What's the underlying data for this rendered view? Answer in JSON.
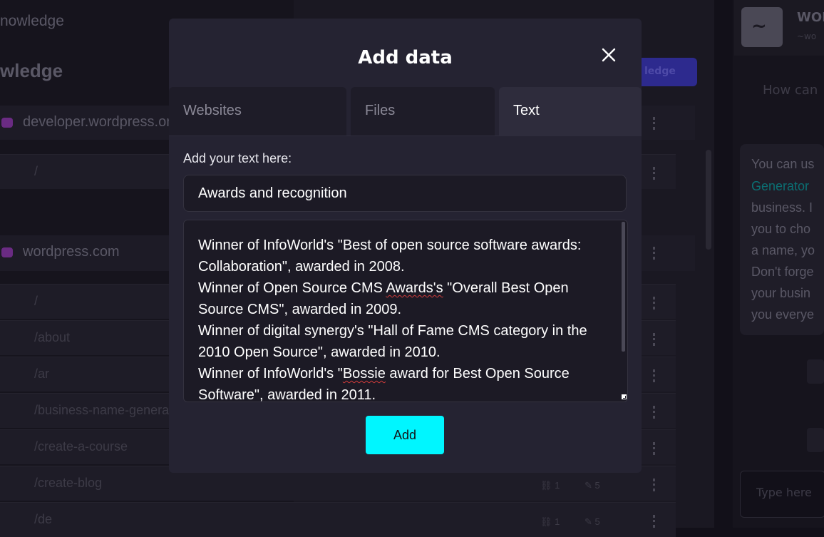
{
  "background": {
    "left_title_partial": "nowledge",
    "left_heading_partial": "wledge",
    "sites": [
      {
        "name": "developer.wordpress.org",
        "paths": [
          "/"
        ]
      },
      {
        "name": "wordpress.com",
        "paths": [
          "/",
          "/about",
          "/ar",
          "/business-name-generator",
          "/create-a-course",
          "/create-blog",
          "/de"
        ]
      }
    ],
    "stat_links": "1",
    "stat_pages": "5",
    "add_knowledge_partial": "ledge",
    "brand_partial": "WOR",
    "brand_sub_partial": "~wo",
    "chat_hint_partial": "How can",
    "chat_lines": [
      "You can us",
      "Generator",
      "business. I",
      "you to cho",
      "a name, yo",
      "Don't forge",
      "your busin",
      "you everye"
    ],
    "chat_input_placeholder": "Type here",
    "logo_glyph": "~"
  },
  "modal": {
    "title": "Add data",
    "close_icon": "close-icon",
    "tabs": [
      {
        "label": "Websites",
        "active": false
      },
      {
        "label": "Files",
        "active": false
      },
      {
        "label": "Text",
        "active": true
      }
    ],
    "field_label": "Add your text here:",
    "title_value": "Awards and recognition",
    "body_paragraphs": [
      {
        "before": "Winner of InfoWorld's \"Best of open source software awards: Collaboration\", awarded in 2008.",
        "spell": "",
        "after": ""
      },
      {
        "before": "Winner of Open Source CMS ",
        "spell": "Awards's",
        "after": " \"Overall Best Open Source CMS\", awarded in 2009."
      },
      {
        "before": "Winner of digital synergy's \"Hall of Fame CMS category in the 2010 Open Source\", awarded in 2010.",
        "spell": "",
        "after": ""
      },
      {
        "before": "Winner of InfoWorld's \"",
        "spell": "Bossie",
        "after": " award for Best Open Source Software\", awarded in 2011."
      }
    ],
    "add_button_label": "Add"
  },
  "colors": {
    "accent_cyan": "#00f6ff",
    "modal_bg": "#252332",
    "backdrop": "#121019"
  }
}
